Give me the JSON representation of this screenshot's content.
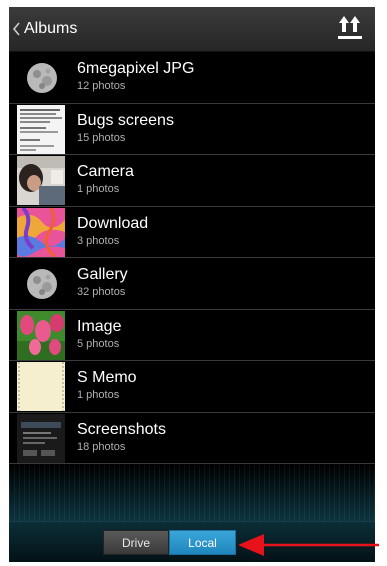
{
  "header": {
    "back_label": "Albums",
    "back_icon": "chevron-left-icon",
    "action_icon": "upload-sort-icon"
  },
  "albums": [
    {
      "title": "6megapixel JPG",
      "count": "12 photos",
      "thumb": "moon"
    },
    {
      "title": "Bugs screens",
      "count": "15 photos",
      "thumb": "document-screenshot"
    },
    {
      "title": "Camera",
      "count": "1 photos",
      "thumb": "person-photo"
    },
    {
      "title": "Download",
      "count": "3 photos",
      "thumb": "colorful-pattern"
    },
    {
      "title": "Gallery",
      "count": "32 photos",
      "thumb": "moon"
    },
    {
      "title": "Image",
      "count": "5 photos",
      "thumb": "tulips"
    },
    {
      "title": "S Memo",
      "count": "1 photos",
      "thumb": "memo-paper"
    },
    {
      "title": "Screenshots",
      "count": "18 photos",
      "thumb": "dark-screenshot"
    }
  ],
  "bottom_tabs": {
    "drive_label": "Drive",
    "local_label": "Local",
    "selected": "Local"
  },
  "colors": {
    "selected_tab": "#2a97cc",
    "annotation_arrow": "#e8121b"
  }
}
